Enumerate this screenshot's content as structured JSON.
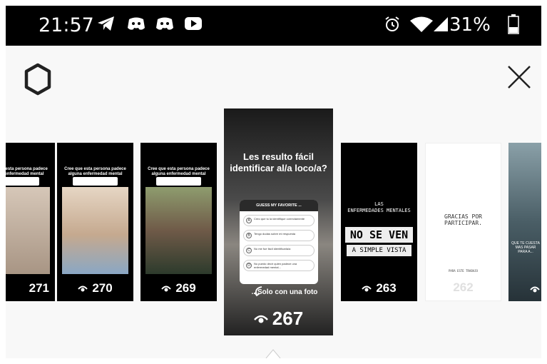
{
  "status_bar": {
    "time": "21:57",
    "battery": "31%",
    "icons": [
      "telegram-icon",
      "discord-icon",
      "discord-icon",
      "youtube-icon",
      "alarm-icon",
      "wifi-icon",
      "signal-icon",
      "battery-icon"
    ]
  },
  "top_bar": {
    "settings_icon": "gear-icon",
    "close_icon": "close-icon"
  },
  "stories": [
    {
      "views": "271",
      "caption": "Cree que esta persona padece alguna enfermedad mental",
      "photo_color": "#c9b8a8"
    },
    {
      "views": "270",
      "caption": "Cree que esta persona padece alguna enfermedad mental",
      "photo_color": "#d8bfa8"
    },
    {
      "views": "269",
      "caption": "Cree que esta persona padece alguna enfermedad mental",
      "photo_color": "#7a8a5a"
    },
    {
      "views": "267",
      "headline": "Les resulto fácil identificar al/a loco/a?",
      "quiz_title": "GUESS MY FAVORITE ...",
      "options": [
        {
          "letter": "A",
          "text": "Creo que tu la identifique correctamente"
        },
        {
          "letter": "B",
          "text": "Tengo dudas sobre mi respuesta"
        },
        {
          "letter": "C",
          "text": "No me fue fácil identificarla/a"
        },
        {
          "letter": "D",
          "text": "No puedo decir quien padece una enfermedad mental..."
        }
      ],
      "subtitle": "...Solo con una foto"
    },
    {
      "views": "263",
      "line1": "LAS",
      "line2": "ENFERMEDADES MENTALES",
      "line3": "NO SE VEN",
      "line4": "A SIMPLE VISTA"
    },
    {
      "views": "262",
      "thanks": "GRACIAS POR PARTICIPAR.",
      "fine": "PARA ESTE TRABAJO"
    },
    {
      "views": "",
      "caption": "QUE TE CUESTA MAS PASAR PARA A..."
    }
  ]
}
